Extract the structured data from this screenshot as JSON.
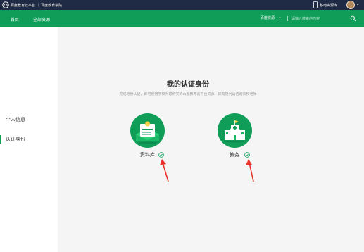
{
  "topbar": {
    "brand": "百度教育云平台 ｜ 百度教育学院",
    "mobile": "移动资源库"
  },
  "navbar": {
    "items": [
      {
        "label": "首页"
      },
      {
        "label": "全部资源"
      }
    ],
    "search": {
      "scope": "百度资源",
      "placeholder": "请输入搜索的内容"
    }
  },
  "sidebar": {
    "items": [
      {
        "label": "个人信息",
        "active": false
      },
      {
        "label": "认证身份",
        "active": true
      }
    ]
  },
  "main": {
    "title": "我的认证身份",
    "subtitle": "完成身份认证，即可使用学校为您购买的百度教育云平台资源，如有疑问请咨询贵校老师",
    "cards": [
      {
        "label": "资料库",
        "icon": "document-library-icon",
        "verified": true
      },
      {
        "label": "教务",
        "icon": "school-building-icon",
        "verified": true
      }
    ]
  },
  "colors": {
    "topbar": "#1f2a44",
    "accent": "#0f9d58",
    "arrow": "#e8322b"
  }
}
